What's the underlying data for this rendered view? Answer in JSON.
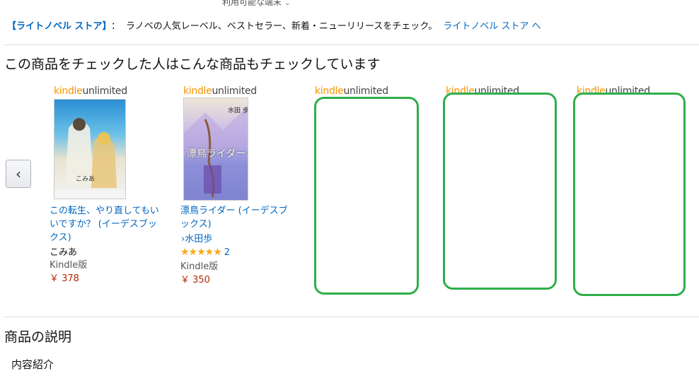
{
  "device_link": {
    "label": "利用可能な端末"
  },
  "promo": {
    "store_name": "【ライトノベル ストア】",
    "colon": "：",
    "description": "ラノベの人気レーベル、ベストセラー、新着・ニューリリースをチェック。",
    "link_label": "ライトノベル ストア へ"
  },
  "recommendations": {
    "title": "この商品をチェックした人はこんな商品もチェックしています",
    "prev_arrow": "‹",
    "kindle_unlimited": {
      "k": "kindle",
      "u": "unlimited"
    },
    "items": [
      {
        "cover_text": "この転生、やり直してもいいですか？",
        "cover_author": "こみあ",
        "title_line1": "この転生、やり直してもい",
        "title_line2": "いですか？ (イーデスブッ",
        "title_line3": "クス)",
        "author": "こみあ",
        "format": "Kindle版",
        "price": "￥ 378"
      },
      {
        "cover_text": "漂鳥ライダー",
        "cover_author": "水田 歩",
        "title_line1": "漂鳥ライダー (イーデスブ",
        "title_line2": "ックス)",
        "author_prefix": "›",
        "author": "水田歩",
        "stars": "★★★★★",
        "review_count": "2",
        "format": "Kindle版",
        "price": "￥ 350"
      }
    ]
  },
  "product_description": {
    "title": "商品の説明",
    "subtitle": "内容紹介"
  },
  "colors": {
    "link": "#0066c0",
    "price": "#b12704",
    "placeholder_border": "#2fae4a",
    "kindle_orange": "#f79400"
  }
}
